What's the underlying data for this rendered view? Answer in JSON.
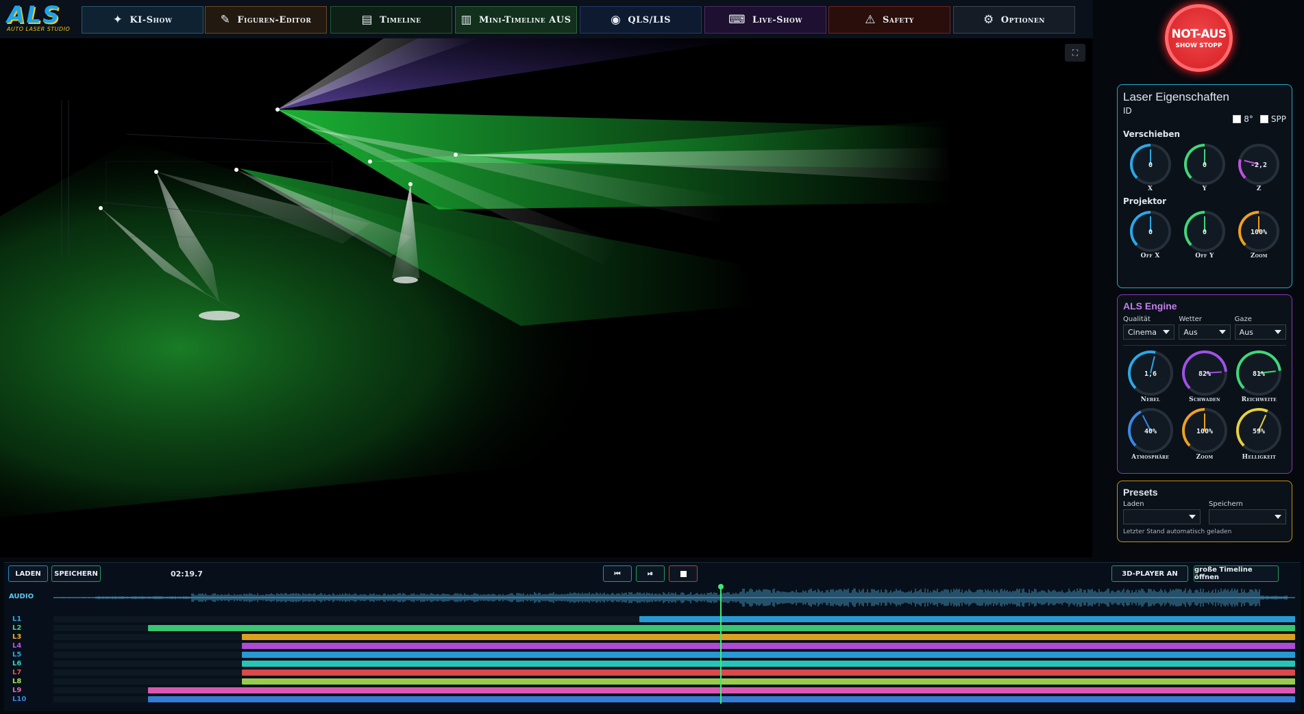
{
  "header": {
    "logo": {
      "text": "ALS",
      "subtitle": "AUTO LASER STUDIO"
    },
    "nav": [
      {
        "label": "KI-Show",
        "icon": "sparkle-icon",
        "glyph": "✦",
        "border": "#2b5a70",
        "bg": "#0f2232"
      },
      {
        "label": "Figuren-Editor",
        "icon": "pen-icon",
        "glyph": "✎",
        "border": "#6a4a22",
        "bg": "#221a10"
      },
      {
        "label": "Timeline",
        "icon": "list-icon",
        "glyph": "▤",
        "border": "#245a36",
        "bg": "#0e2016"
      },
      {
        "label": "Mini-Timeline AUS",
        "icon": "columns-icon",
        "glyph": "▥",
        "border": "#2c6a40",
        "bg": "#12301c"
      },
      {
        "label": "QLS/LIS",
        "icon": "record-icon",
        "glyph": "◉",
        "border": "#223a66",
        "bg": "#0e1a30"
      },
      {
        "label": "Live-Show",
        "icon": "keyboard-icon",
        "glyph": "⌨",
        "border": "#4e2a66",
        "bg": "#1e1030"
      },
      {
        "label": "Safety",
        "icon": "warning-icon",
        "glyph": "⚠",
        "border": "#6a2622",
        "bg": "#2a0e0c"
      },
      {
        "label": "Optionen",
        "icon": "gear-icon",
        "glyph": "⚙",
        "border": "#3a4654",
        "bg": "#151c26"
      }
    ]
  },
  "emergency": {
    "title": "NOT-AUS",
    "subtitle": "SHOW STOPP"
  },
  "laser_props": {
    "title": "Laser Eigenschaften",
    "id_label": "ID",
    "checks": [
      {
        "label": "8°"
      },
      {
        "label": "SPP"
      }
    ],
    "move_title": "Verschieben",
    "move_knobs": [
      {
        "label": "X",
        "value": "0",
        "color": "#2aa8e8",
        "level": 0.5
      },
      {
        "label": "Y",
        "value": "0",
        "color": "#3ed87a",
        "level": 0.5
      },
      {
        "label": "Z",
        "value": "-2,2",
        "color": "#c050e0",
        "level": 0.22
      }
    ],
    "proj_title": "Projektor",
    "proj_knobs": [
      {
        "label": "Off X",
        "value": "0",
        "color": "#2aa8e8",
        "level": 0.5
      },
      {
        "label": "Off Y",
        "value": "0",
        "color": "#3ed87a",
        "level": 0.5
      },
      {
        "label": "Zoom",
        "value": "100%",
        "color": "#f0a020",
        "level": 0.5
      }
    ]
  },
  "engine": {
    "title": "ALS Engine",
    "selects": [
      {
        "label": "Qualität",
        "value": "Cinema"
      },
      {
        "label": "Wetter",
        "value": "Aus"
      },
      {
        "label": "Gaze",
        "value": "Aus"
      }
    ],
    "knobs_row1": [
      {
        "label": "Nebel",
        "value": "1,6",
        "color": "#2aa8e8",
        "level": 0.55
      },
      {
        "label": "Schwaden",
        "value": "82%",
        "color": "#a050e8",
        "level": 0.82
      },
      {
        "label": "Reichweite",
        "value": "81%",
        "color": "#3ed87a",
        "level": 0.81
      }
    ],
    "knobs_row2": [
      {
        "label": "Atmosphäre",
        "value": "40%",
        "color": "#3a88e8",
        "level": 0.4
      },
      {
        "label": "Zoom",
        "value": "100%",
        "color": "#f0a020",
        "level": 0.5
      },
      {
        "label": "Helligkeit",
        "value": "59%",
        "color": "#e8d040",
        "level": 0.59
      }
    ]
  },
  "presets": {
    "title": "Presets",
    "load_label": "Laden",
    "save_label": "Speichern",
    "status": "Letzter Stand automatisch geladen"
  },
  "timeline": {
    "load": "LADEN",
    "save": "SPEICHERN",
    "time": "02:19.7",
    "player_toggle": "3D-PLAYER AN",
    "open_big": "große Timeline öffnen",
    "audio_label": "AUDIO",
    "tracks": [
      {
        "label": "L1",
        "color": "#2aa8e8"
      },
      {
        "label": "L2",
        "color": "#3ed87a"
      },
      {
        "label": "L3",
        "color": "#f0b020"
      },
      {
        "label": "L4",
        "color": "#c050e8"
      },
      {
        "label": "L5",
        "color": "#2aa8e8"
      },
      {
        "label": "L6",
        "color": "#2ad8c8"
      },
      {
        "label": "L7",
        "color": "#f05050"
      },
      {
        "label": "L8",
        "color": "#a8e050"
      },
      {
        "label": "L9",
        "color": "#f060c0"
      },
      {
        "label": "L10",
        "color": "#3a88e8"
      }
    ]
  }
}
